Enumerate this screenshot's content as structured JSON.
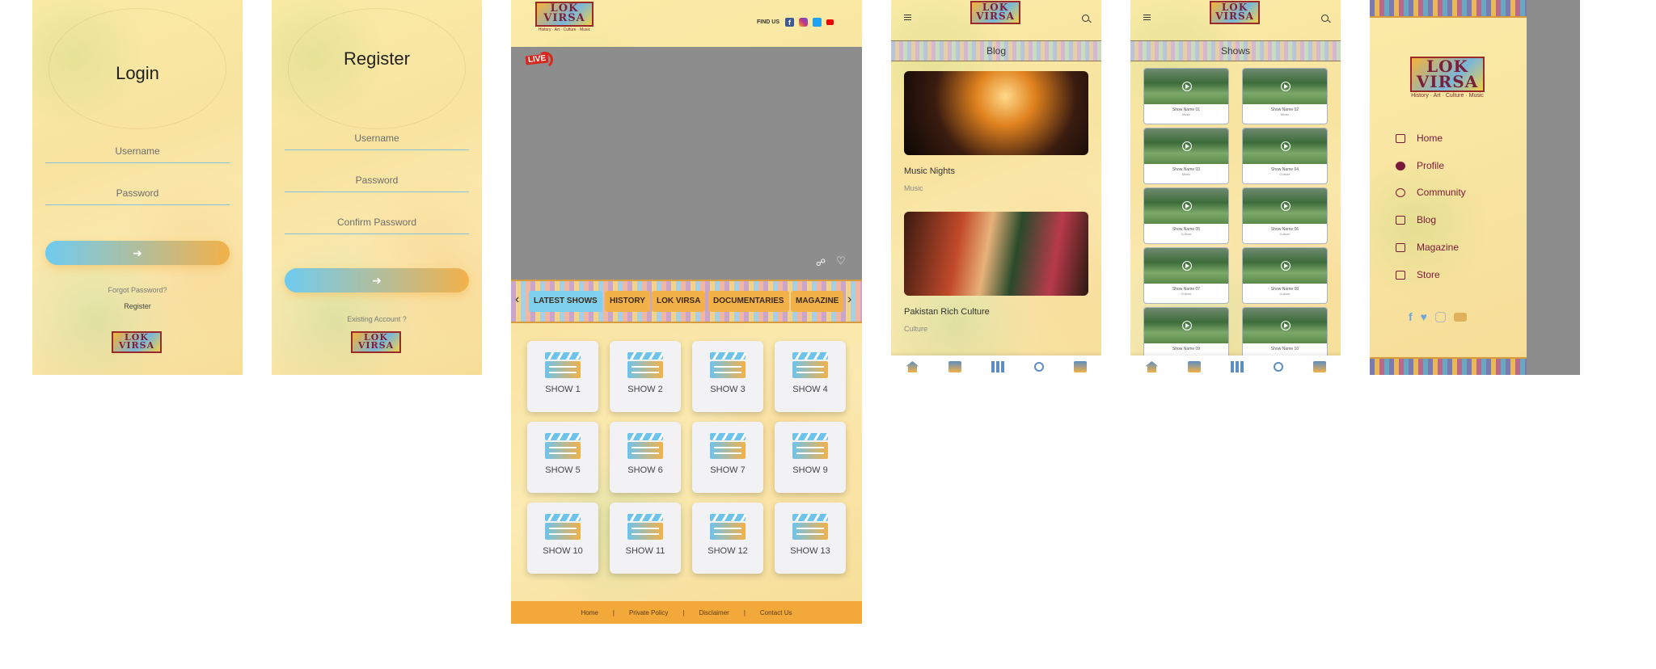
{
  "login": {
    "title": "Login",
    "username_placeholder": "Username",
    "password_placeholder": "Password",
    "submit_icon": "arrow-right-icon",
    "forgot": "Forgot Password?",
    "register": "Register",
    "logo_text": "LOK VIRSA"
  },
  "register": {
    "title": "Register",
    "username_placeholder": "Username",
    "password_placeholder": "Password",
    "confirm_placeholder": "Confirm Password",
    "submit_icon": "arrow-right-icon",
    "existing": "Existing Account ?",
    "logo_text": "LOK VIRSA"
  },
  "home": {
    "logo_text": "LOK VIRSA",
    "logo_tagline": "History · Art · Culture · Music",
    "find_us": "FIND US",
    "social_icons": [
      "facebook-icon",
      "instagram-icon",
      "twitter-icon",
      "youtube-icon"
    ],
    "live_label": "LIVE",
    "tabs": [
      "LATEST SHOWS",
      "HISTORY",
      "LOK VIRSA",
      "DOCUMENTARIES",
      "MAGAZINE"
    ],
    "shows": [
      "SHOW 1",
      "SHOW 2",
      "SHOW 3",
      "SHOW 4",
      "SHOW 5",
      "SHOW 6",
      "SHOW 7",
      "SHOW 9",
      "SHOW 10",
      "SHOW 11",
      "SHOW 12",
      "SHOW 13"
    ],
    "footer": [
      "Home",
      "|",
      "Private Policy",
      "|",
      "Disclaimer",
      "|",
      "Contact Us"
    ]
  },
  "blog": {
    "header_title": "Blog",
    "posts": [
      {
        "title": "Music Nights",
        "category": "Music"
      },
      {
        "title": "Pakistan Rich Culture",
        "category": "Culture"
      }
    ]
  },
  "shows_list": {
    "header_title": "Shows",
    "items": [
      {
        "name": "Show Name 01",
        "category": "Music"
      },
      {
        "name": "Show Name 02",
        "category": "Music"
      },
      {
        "name": "Show Name 03",
        "category": "Music"
      },
      {
        "name": "Show Name 04",
        "category": "Culture"
      },
      {
        "name": "Show Name 05",
        "category": "Culture"
      },
      {
        "name": "Show Name 06",
        "category": "Culture"
      },
      {
        "name": "Show Name 07",
        "category": "Culture"
      },
      {
        "name": "Show Name 08",
        "category": "Culture"
      },
      {
        "name": "Show Name 09",
        "category": ""
      },
      {
        "name": "Show Name 10",
        "category": ""
      }
    ]
  },
  "side_menu": {
    "logo_text": "LOK VIRSA",
    "logo_tagline": "History · Art · Culture · Music",
    "items": [
      "Home",
      "Profile",
      "Community",
      "Blog",
      "Magazine",
      "Store"
    ],
    "social_icons": [
      "facebook-icon",
      "twitter-icon",
      "instagram-icon",
      "youtube-icon"
    ]
  },
  "colors": {
    "accent_orange": "#f3b14a",
    "accent_blue": "#6ecbf0",
    "menu_text": "#7a1a3a"
  }
}
